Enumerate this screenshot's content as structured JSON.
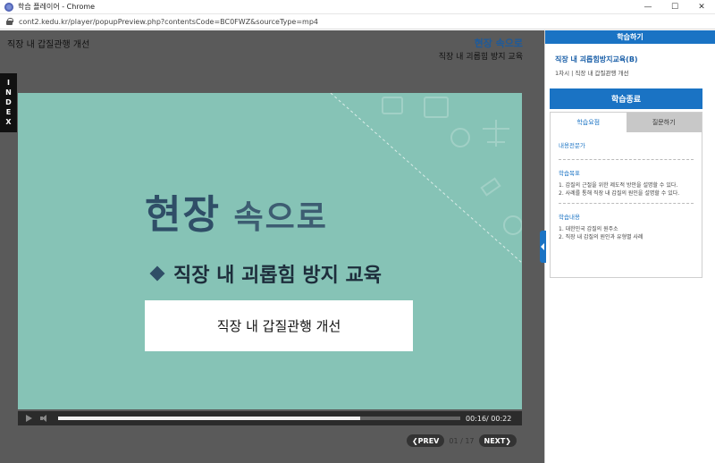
{
  "window": {
    "title": "학습 플레이어 - Chrome",
    "minimize": "—",
    "maximize": "☐",
    "close": "✕"
  },
  "address": {
    "url": "cont2.kedu.kr/player/popupPreview.php?contentsCode=BC0FWZ&sourceType=mp4"
  },
  "player": {
    "lesson_title": "직장 내 갑질관행 개선",
    "brand": "현장 속으로",
    "course_subtitle": "직장 내 괴롭힘 방지 교육",
    "index_tab": "I\nN\nD\nE\nX",
    "slide": {
      "big_title_a": "현장",
      "big_title_b": " 속으로",
      "subtitle": "직장 내 괴롭힘 방지 교육",
      "box_text": "직장 내 갑질관행 개선"
    },
    "controls": {
      "progress": 0.75,
      "time": "00:16/ 00:22"
    },
    "pager": {
      "prev": "❮PREV",
      "page": "01 / 17",
      "next": "NEXT❯"
    }
  },
  "panel": {
    "header": "학습하기",
    "course_name": "직장 내 괴롭힘방지교육(B)",
    "course_meta": "1차시 | 직장 내 갑질관행 개선",
    "end_button": "학습종료",
    "tabs": [
      "학습요점",
      "질문하기"
    ],
    "sections": [
      {
        "title": "내용전문가",
        "lines": []
      },
      {
        "title": "학습목표",
        "lines": [
          "1. 갑질의 근절을 위한 제도적 방안을 설명할 수 있다.",
          "2. 사례를 통해 직장 내 갑질의 원인을 설명할 수 있다."
        ]
      },
      {
        "title": "학습내용",
        "lines": [
          "1. 대한민국 갑질의 원주소",
          "2. 직장 내 갑질의 원인과 유형별 사례"
        ]
      }
    ]
  },
  "colors": {
    "accent": "#1a73c4",
    "slide_bg": "#86c3b6"
  }
}
